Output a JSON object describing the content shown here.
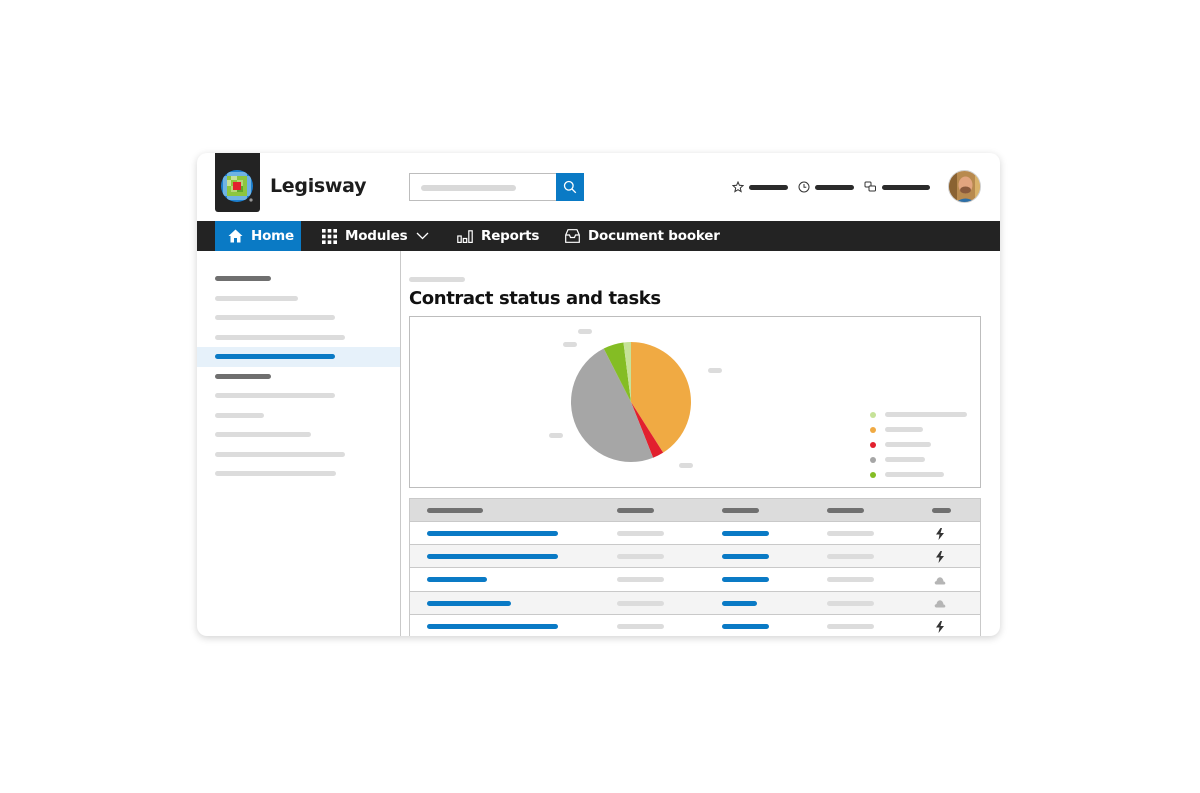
{
  "app": {
    "brand": "Legisway",
    "colors": {
      "accent": "#0a7ac5",
      "nav_bg": "#232323",
      "selected_bg": "#e6f1fa"
    }
  },
  "header": {
    "search": {
      "placeholder": "",
      "icon": "search-icon"
    },
    "tools": [
      {
        "icon": "star-icon",
        "label": ""
      },
      {
        "icon": "clock-icon",
        "label": ""
      },
      {
        "icon": "chat-icon",
        "label": ""
      }
    ],
    "avatar": "user-avatar"
  },
  "nav": {
    "items": [
      {
        "label": "Home",
        "icon": "home-icon",
        "active": true
      },
      {
        "label": "Modules",
        "icon": "grid-icon",
        "dropdown": true
      },
      {
        "label": "Reports",
        "icon": "bar-chart-icon"
      },
      {
        "label": "Document booker",
        "icon": "inbox-icon"
      }
    ]
  },
  "sidebar": {
    "items": [
      {
        "type": "heading",
        "label": ""
      },
      {
        "type": "link",
        "label": ""
      },
      {
        "type": "link",
        "label": ""
      },
      {
        "type": "link",
        "label": ""
      },
      {
        "type": "link",
        "label": "",
        "selected": true
      },
      {
        "type": "heading",
        "label": ""
      },
      {
        "type": "link",
        "label": ""
      },
      {
        "type": "link",
        "label": ""
      },
      {
        "type": "link",
        "label": ""
      },
      {
        "type": "link",
        "label": ""
      },
      {
        "type": "link",
        "label": ""
      }
    ]
  },
  "main": {
    "breadcrumb": "",
    "title": "Contract status and tasks",
    "table": {
      "columns": [
        "",
        "",
        "",
        "",
        ""
      ],
      "rows": [
        {
          "status_icon": "lightning-icon"
        },
        {
          "status_icon": "lightning-icon"
        },
        {
          "status_icon": "cloud-icon"
        },
        {
          "status_icon": "cloud-icon"
        },
        {
          "status_icon": "lightning-icon"
        }
      ]
    }
  },
  "chart_data": {
    "type": "pie",
    "title": "",
    "legend_position": "right",
    "series": [
      {
        "name": "",
        "value": 41,
        "color": "#f0aa43"
      },
      {
        "name": "",
        "value": 3,
        "color": "#e2202e"
      },
      {
        "name": "",
        "value": 48.5,
        "color": "#a6a6a6"
      },
      {
        "name": "",
        "value": 5.5,
        "color": "#84bd24"
      },
      {
        "name": "",
        "value": 2,
        "color": "#c6e298"
      }
    ],
    "legend_order": [
      4,
      0,
      1,
      2,
      3
    ]
  }
}
